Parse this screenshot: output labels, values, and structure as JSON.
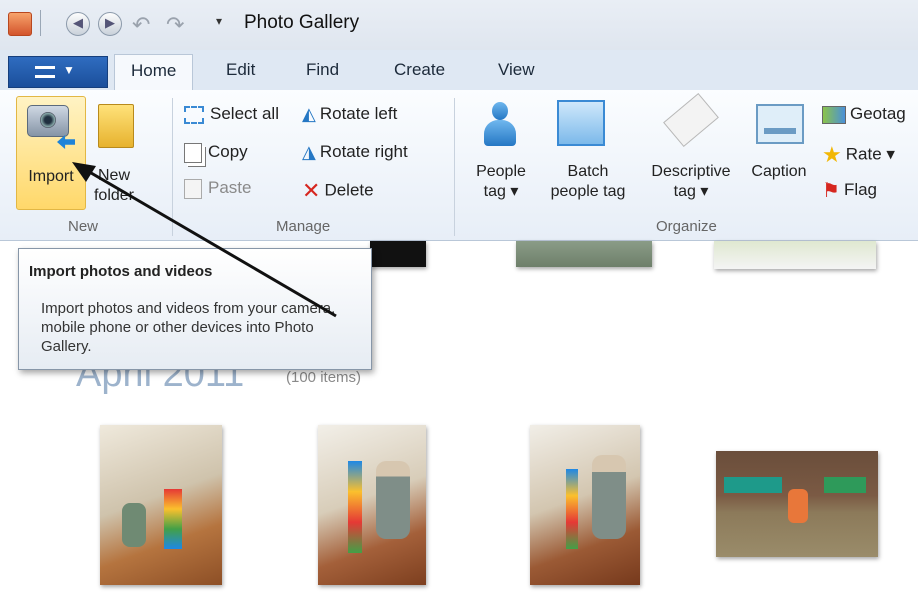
{
  "window": {
    "title": "Photo Gallery"
  },
  "quick_access": {
    "customize": "▾",
    "undo_icon": "undo-icon",
    "redo_icon": "redo-icon"
  },
  "tabs": [
    {
      "label": "Home",
      "active": true
    },
    {
      "label": "Edit"
    },
    {
      "label": "Find"
    },
    {
      "label": "Create"
    },
    {
      "label": "View"
    }
  ],
  "ribbon": {
    "groups": {
      "new": "New",
      "manage": "Manage",
      "organize": "Organize"
    },
    "import_label": "Import",
    "new_folder_line1": "New",
    "new_folder_line2": "folder",
    "select_all": "Select all",
    "copy": "Copy",
    "paste": "Paste",
    "rotate_left": "Rotate left",
    "rotate_right": "Rotate right",
    "delete": "Delete",
    "people_tag_line1": "People",
    "people_tag_line2": "tag ▾",
    "batch_line1": "Batch",
    "batch_line2": "people tag",
    "descriptive_line1": "Descriptive",
    "descriptive_line2": "tag ▾",
    "caption": "Caption",
    "geotag": "Geotag",
    "rate": "Rate ▾",
    "flag": "Flag"
  },
  "tooltip": {
    "title": "Import photos and videos",
    "body": "Import photos and videos from your camera, mobile phone or other devices into Photo Gallery."
  },
  "gallery": {
    "month_title": "April 2011",
    "month_count": "(100 items)"
  },
  "colors": {
    "accent": "#1b4f9b",
    "import_highlight": "#ffd86a"
  }
}
